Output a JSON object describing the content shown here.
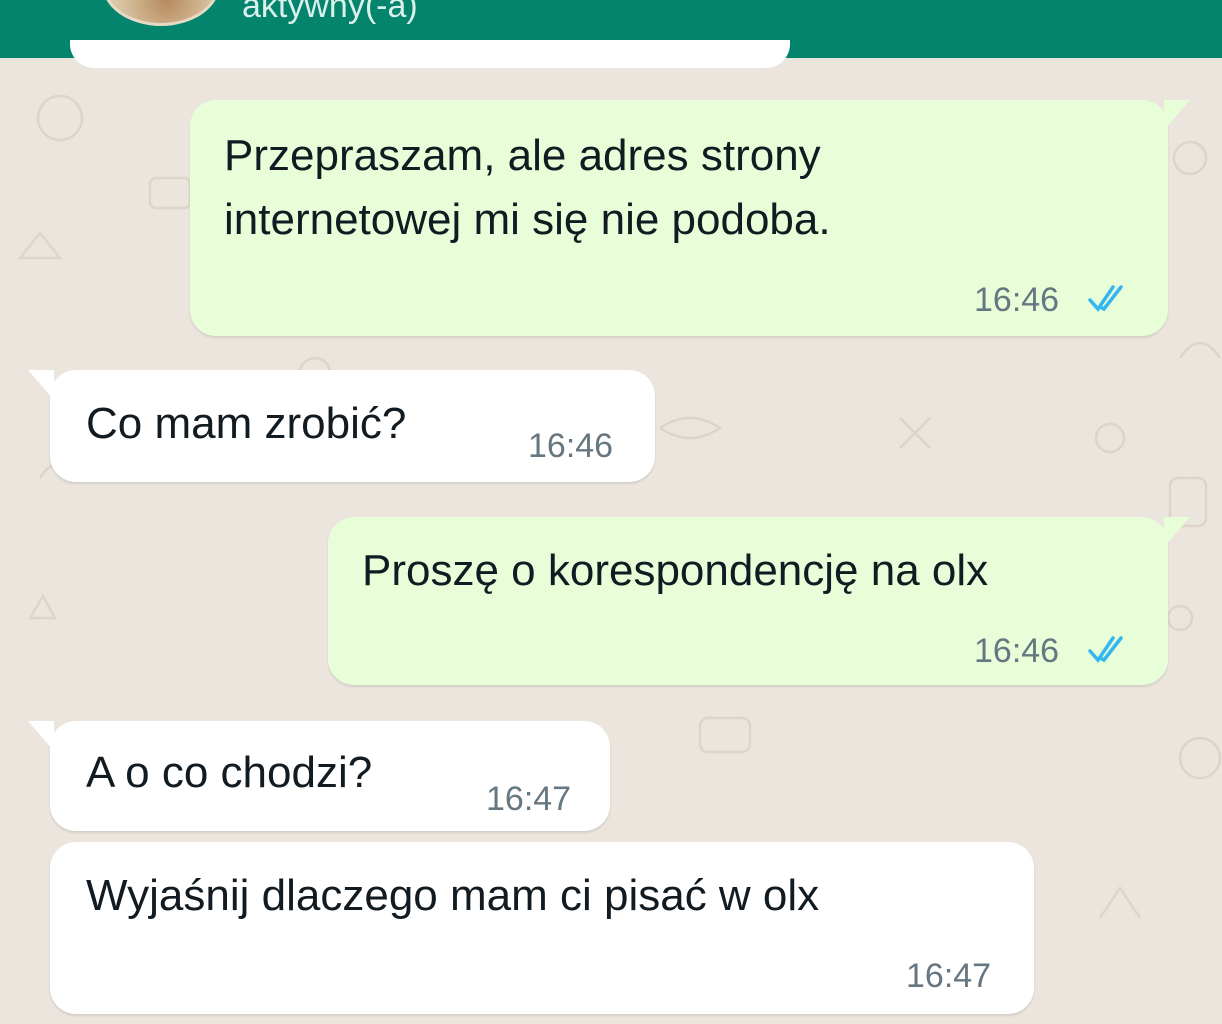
{
  "header": {
    "status": "aktywny(-a)",
    "avatar_icon": "contact-avatar"
  },
  "colors": {
    "header": "#04836d",
    "background": "#ebe5dd",
    "outgoing_bubble": "#e7fed8",
    "incoming_bubble": "#ffffff",
    "read_ticks": "#34b7f1"
  },
  "messages": [
    {
      "direction": "outgoing",
      "lines": [
        "Przepraszam, ale adres strony",
        "internetowej mi się nie podoba."
      ],
      "time": "16:46",
      "status_icon": "double-check-read-icon"
    },
    {
      "direction": "incoming",
      "lines": [
        "Co mam zrobić?"
      ],
      "time": "16:46"
    },
    {
      "direction": "outgoing",
      "lines": [
        "Proszę o korespondencję na olx"
      ],
      "time": "16:46",
      "status_icon": "double-check-read-icon"
    },
    {
      "direction": "incoming",
      "lines": [
        "A o co chodzi?"
      ],
      "time": "16:47"
    },
    {
      "direction": "incoming",
      "lines": [
        "Wyjaśnij dlaczego mam ci pisać w olx"
      ],
      "time": "16:47"
    }
  ]
}
